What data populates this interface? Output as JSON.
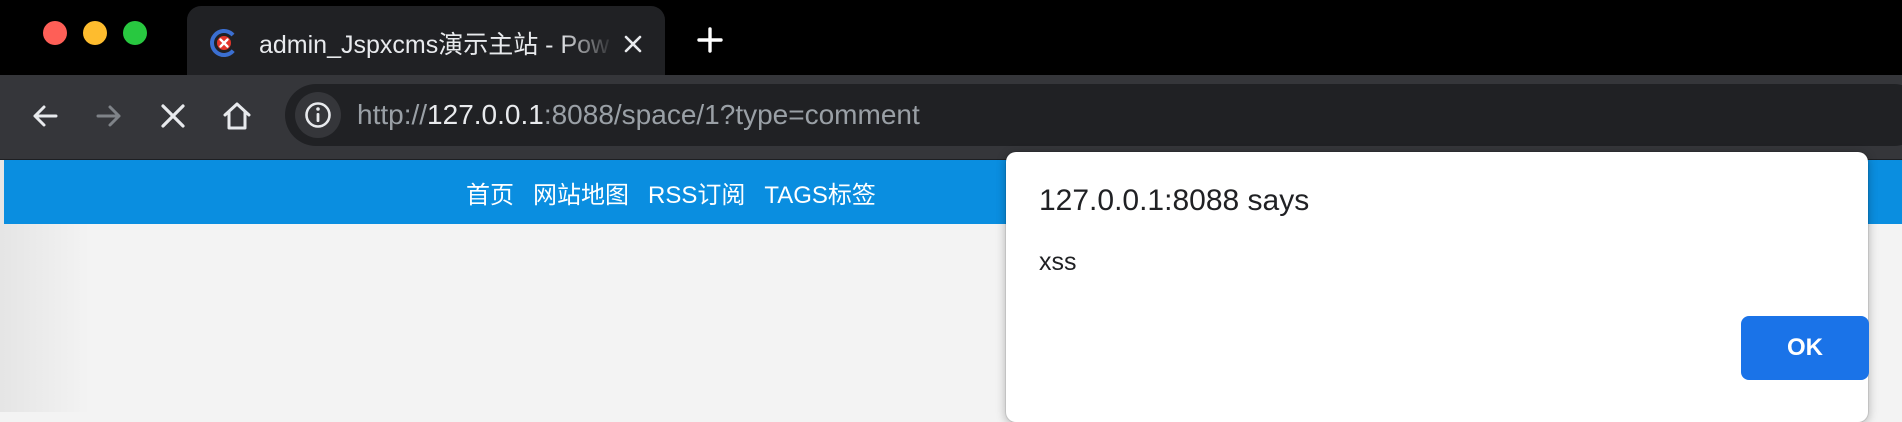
{
  "window": {
    "traffic_lights": [
      "#fe5f57",
      "#febc2e",
      "#28c840"
    ]
  },
  "tab": {
    "title": "admin_Jspxcms演示主站 - Pow",
    "favicon": "jspxcms-logo-icon",
    "close_icon": "close-icon"
  },
  "new_tab_icon": "plus-icon",
  "toolbar": {
    "back_icon": "arrow-left-icon",
    "forward_icon": "arrow-right-icon",
    "stop_icon": "close-x-icon",
    "home_icon": "home-icon"
  },
  "address_bar": {
    "info_icon": "info-circle-icon",
    "url_scheme": "http://",
    "url_host": "127.0.0.1",
    "url_rest": ":8088/space/1?type=comment"
  },
  "site_nav": {
    "items": [
      {
        "label": "首页"
      },
      {
        "label": "网站地图"
      },
      {
        "label": "RSS订阅"
      },
      {
        "label": "TAGS标签"
      }
    ],
    "background": "#0a8ee0"
  },
  "dialog": {
    "title": "127.0.0.1:8088 says",
    "message": "xss",
    "ok_label": "OK",
    "ok_color": "#1a73e8"
  }
}
